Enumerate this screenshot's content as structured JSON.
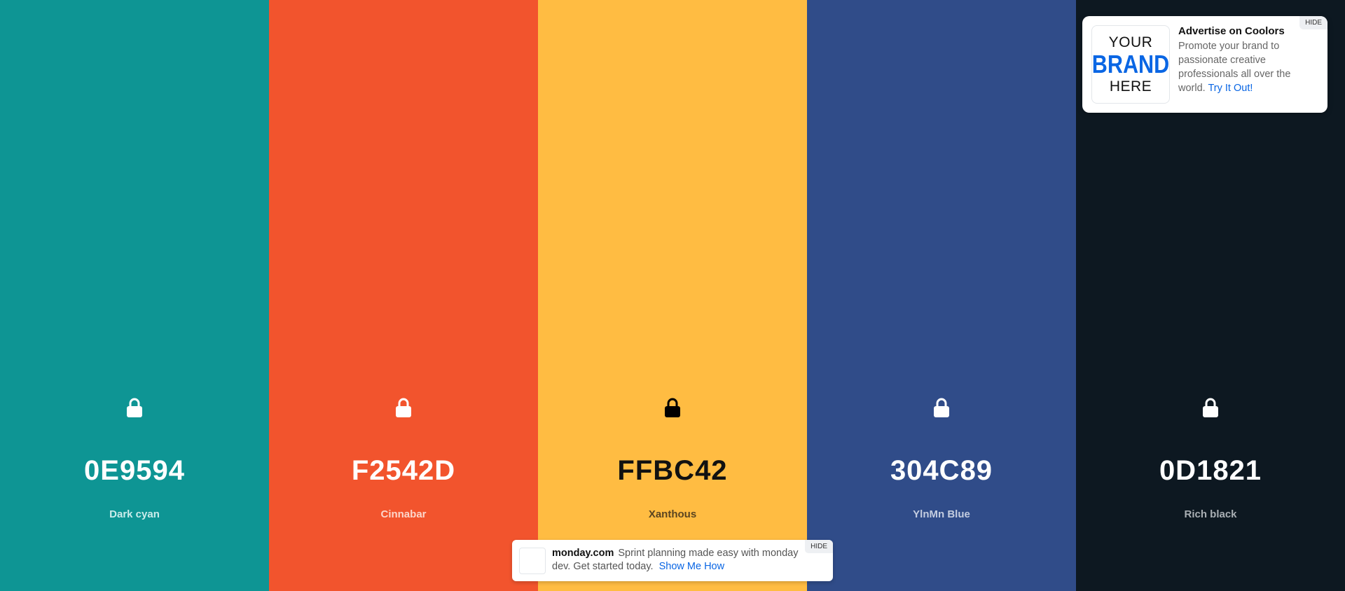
{
  "swatches": [
    {
      "hex": "0E9594",
      "name": "Dark cyan",
      "bg": "#0E9594",
      "text_color": "#ffffff",
      "name_color": "#cbeceb",
      "lock_color": "#ffffff"
    },
    {
      "hex": "F2542D",
      "name": "Cinnabar",
      "bg": "#F2542D",
      "text_color": "#ffffff",
      "name_color": "#fcd6cb",
      "lock_color": "#ffffff"
    },
    {
      "hex": "FFBC42",
      "name": "Xanthous",
      "bg": "#FFBC42",
      "text_color": "#111111",
      "name_color": "#5a4420",
      "lock_color": "#000000"
    },
    {
      "hex": "304C89",
      "name": "YlnMn Blue",
      "bg": "#304C89",
      "text_color": "#ffffff",
      "name_color": "#c4cde0",
      "lock_color": "#ffffff"
    },
    {
      "hex": "0D1821",
      "name": "Rich black",
      "bg": "#0D1821",
      "text_color": "#ffffff",
      "name_color": "#a9afb4",
      "lock_color": "#ffffff"
    }
  ],
  "lock_icon": "lock-icon",
  "ad": {
    "logo_line1": "YOUR",
    "logo_line2": "BRAND",
    "logo_line3": "HERE",
    "title": "Advertise on Coolors",
    "description": "Promote your brand to passionate creative professionals all over the world.",
    "link_text": "Try It Out!",
    "hide_label": "HIDE"
  },
  "bottom_ad": {
    "brand": "monday.com",
    "text": "Sprint planning made easy with monday dev. Get started today.",
    "link_text": "Show Me How",
    "hide_label": "HIDE"
  }
}
